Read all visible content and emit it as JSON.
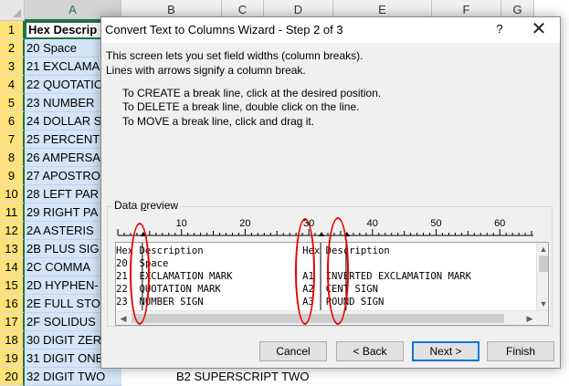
{
  "sheet": {
    "columns": [
      "A",
      "B",
      "C",
      "D",
      "E",
      "F",
      "G"
    ],
    "rows": [
      "1",
      "2",
      "3",
      "4",
      "5",
      "6",
      "7",
      "8",
      "9",
      "10",
      "11",
      "12",
      "13",
      "14",
      "15",
      "16",
      "17",
      "18",
      "19",
      "20"
    ],
    "columnA": [
      "Hex Descrip",
      "20  Space",
      "21  EXCLAMA",
      "22  QUOTATIO",
      "23  NUMBER",
      "24  DOLLAR S",
      "25  PERCENT",
      "26  AMPERSA",
      "27  APOSTRO",
      "28  LEFT PAR",
      "29  RIGHT PA",
      "2A  ASTERIS",
      "2B  PLUS SIG",
      "2C  COMMA",
      "2D  HYPHEN-",
      "2E  FULL STO",
      "2F  SOLIDUS",
      "30  DIGIT ZER",
      "31  DIGIT ONE",
      "32  DIGIT TWO"
    ],
    "row20_colB": "B2  SUPERSCRIPT TWO"
  },
  "dialog": {
    "title": "Convert Text to Columns Wizard - Step 2 of 3",
    "help_label": "?",
    "close_label": "✕",
    "intro_line1": "This screen lets you set field widths (column breaks).",
    "intro_line2": "Lines with arrows signify a column break.",
    "instructions": [
      "To CREATE a break line, click at the desired position.",
      "To DELETE a break line, double click on the line.",
      "To MOVE a break line, click and drag it."
    ],
    "preview_label_pre": "Data ",
    "preview_label_u": "p",
    "preview_label_post": "review",
    "ruler_ticks": [
      "10",
      "20",
      "30",
      "40",
      "50",
      "60"
    ],
    "preview_rows": [
      "Hex Description                 Hex Description",
      "20  Space",
      "21  EXCLAMATION MARK            A1  INVERTED EXCLAMATION MARK",
      "22  QUOTATION MARK              A2  CENT SIGN",
      "23  NUMBER SIGN                 A3  POUND SIGN"
    ],
    "buttons": {
      "cancel": "Cancel",
      "back": "< Back",
      "next": "Next >",
      "finish": "Finish"
    }
  },
  "colors": {
    "selection_blue": "#d3e5f7",
    "excel_green": "#217346",
    "annotation_red": "#e60000",
    "default_button_border": "#0078d7"
  }
}
